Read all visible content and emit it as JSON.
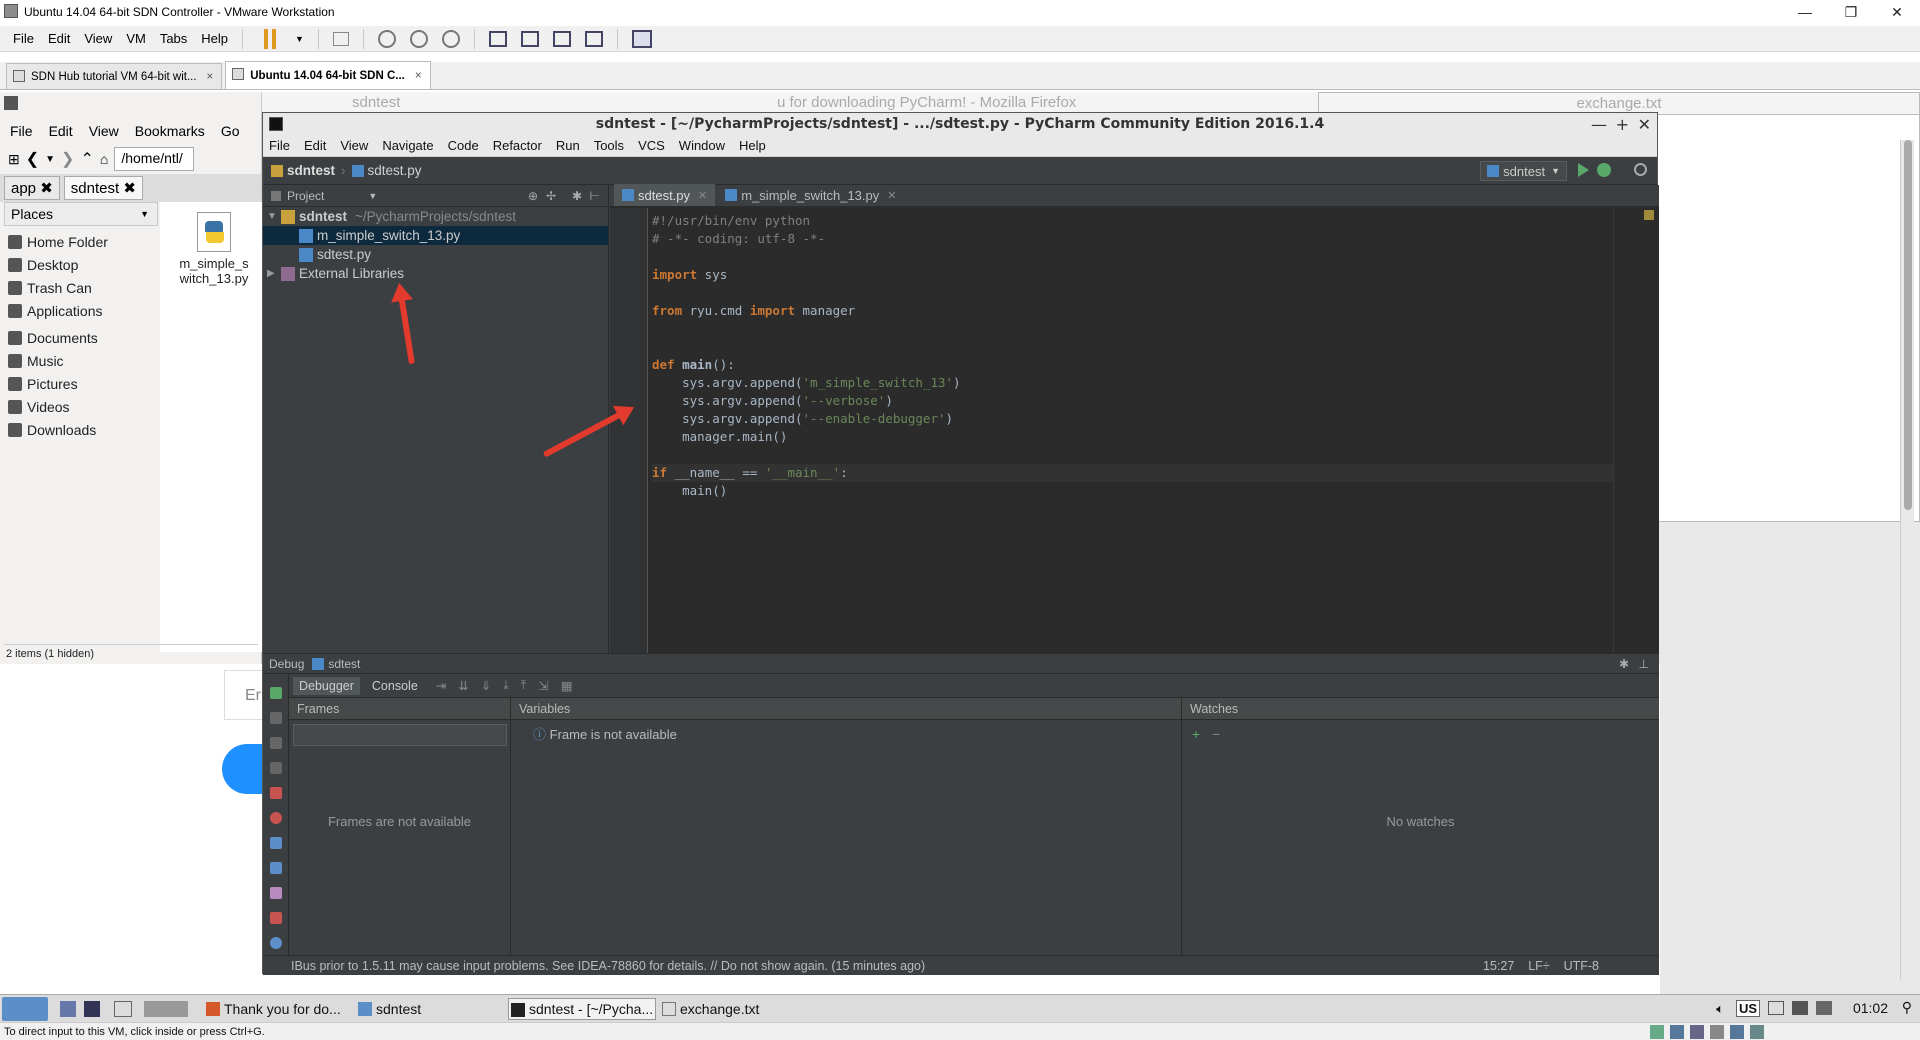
{
  "vmware": {
    "title": "Ubuntu 14.04 64-bit SDN Controller - VMware Workstation",
    "menu": [
      "File",
      "Edit",
      "View",
      "VM",
      "Tabs",
      "Help"
    ],
    "tabs": [
      {
        "label": "SDN Hub tutorial VM 64-bit wit...",
        "close": "×"
      },
      {
        "label": "Ubuntu 14.04 64-bit SDN C...",
        "close": "×"
      }
    ],
    "status_hint": "To direct input to this VM, click inside or press Ctrl+G."
  },
  "nautilus": {
    "menu": [
      "File",
      "Edit",
      "View",
      "Bookmarks",
      "Go"
    ],
    "path": "/home/ntl/",
    "tabs": [
      "app",
      "sdntest"
    ],
    "places_header": "Places",
    "places": [
      "Home Folder",
      "Desktop",
      "Trash Can",
      "Applications",
      "Documents",
      "Music",
      "Pictures",
      "Videos",
      "Downloads"
    ],
    "file": {
      "name_line1": "m_simple_s",
      "name_line2": "witch_13.py"
    },
    "status": "2 items (1 hidden)"
  },
  "background": {
    "sdntest_strip": "sdntest",
    "firefox_strip": "u for downloading PyCharm! - Mozilla Firefox",
    "exchange_title": "exchange.txt",
    "firefox_input_placeholder": "Er"
  },
  "pycharm": {
    "title": "sdntest - [~/PycharmProjects/sdntest] - .../sdtest.py - PyCharm Community Edition 2016.1.4",
    "menu": [
      "File",
      "Edit",
      "View",
      "Navigate",
      "Code",
      "Refactor",
      "Run",
      "Tools",
      "VCS",
      "Window",
      "Help"
    ],
    "breadcrumb": {
      "project": "sdntest",
      "file": "sdtest.py"
    },
    "run_config": "sdntest",
    "project_panel": {
      "title": "Project",
      "root": {
        "name": "sdntest",
        "path": "~/PycharmProjects/sdntest"
      },
      "files": [
        "m_simple_switch_13.py",
        "sdtest.py"
      ],
      "external": "External Libraries"
    },
    "editor_tabs": [
      "sdtest.py",
      "m_simple_switch_13.py"
    ],
    "code_lines": [
      "#!/usr/bin/env python",
      "# -*- coding: utf-8 -*-",
      "",
      "import sys",
      "",
      "from ryu.cmd import manager",
      "",
      "",
      "def main():",
      "    sys.argv.append('m_simple_switch_13')",
      "    sys.argv.append('--verbose')",
      "    sys.argv.append('--enable-debugger')",
      "    manager.main()",
      "",
      "if __name__ == '__main__':",
      "    main()"
    ],
    "debug": {
      "header": "Debug",
      "config": "sdtest",
      "tabs": [
        "Debugger",
        "Console"
      ],
      "frames_title": "Frames",
      "frames_msg": "Frames are not available",
      "variables_title": "Variables",
      "variables_msg": "Frame is not available",
      "watches_title": "Watches",
      "watches_msg": "No watches"
    },
    "status": {
      "message": "IBus prior to 1.5.11 may cause input problems. See IDEA-78860 for details. // Do not show again. (15 minutes ago)",
      "position": "15:27",
      "line_sep": "LF÷",
      "encoding": "UTF-8"
    }
  },
  "taskbar": {
    "items": [
      "Thank you for do...",
      "sdntest",
      "sdntest - [~/Pycha...",
      "exchange.txt"
    ],
    "layout": "US",
    "clock": "01:02"
  },
  "colors": {
    "accent_red": "#e33a2e",
    "pycharm_bg": "#2b2b2b",
    "keyword": "#cc7832",
    "string": "#6a8759"
  }
}
